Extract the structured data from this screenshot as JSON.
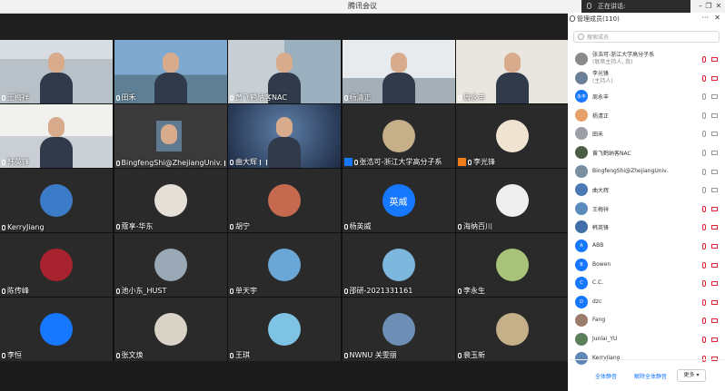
{
  "window": {
    "title": "腾讯会议",
    "speaking_label": "正在讲话:",
    "min": "–",
    "restore": "❐",
    "close": "✕"
  },
  "tiles": [
    {
      "name": "王梅祥",
      "kind": "video"
    },
    {
      "name": "田禾",
      "kind": "video"
    },
    {
      "name": "黄飞鹤纳客NAC",
      "kind": "video"
    },
    {
      "name": "杨清正",
      "kind": "video"
    },
    {
      "name": "周永丰",
      "kind": "video"
    },
    {
      "name": "韩英锋",
      "kind": "video"
    },
    {
      "name": "BingfengShi@ZhejiangUniv.",
      "kind": "video"
    },
    {
      "name": "曲大辉",
      "kind": "video"
    },
    {
      "name": "张浩可-浙江大学高分子系",
      "kind": "avatar"
    },
    {
      "name": "李光锋",
      "kind": "avatar"
    },
    {
      "name": "KerryJiang",
      "kind": "avatar"
    },
    {
      "name": "蔻享-华东",
      "kind": "avatar"
    },
    {
      "name": "胡宁",
      "kind": "avatar"
    },
    {
      "name": "杨英威",
      "kind": "text",
      "avatar_text": "英威"
    },
    {
      "name": "海纳百川",
      "kind": "avatar"
    },
    {
      "name": "陈传峰",
      "kind": "avatar"
    },
    {
      "name": "池小东_HUST",
      "kind": "avatar"
    },
    {
      "name": "单天宇",
      "kind": "avatar"
    },
    {
      "name": "邵研-2021331161",
      "kind": "avatar"
    },
    {
      "name": "李永生",
      "kind": "avatar"
    },
    {
      "name": "李恒",
      "kind": "avatar"
    },
    {
      "name": "张文焕",
      "kind": "avatar"
    },
    {
      "name": "王琪",
      "kind": "avatar"
    },
    {
      "name": "NWNU 关雯丽",
      "kind": "avatar"
    },
    {
      "name": "裴玉新",
      "kind": "avatar"
    }
  ],
  "panel": {
    "title": "管理成员(110)",
    "more": "···",
    "close": "✕",
    "search_placeholder": "搜索成员",
    "members": [
      {
        "name": "张浩可-浙江大学高分子系",
        "role": "(联席主持人, 我)",
        "color": "#8a8a8a"
      },
      {
        "name": "李光锋",
        "role": "(主持人)",
        "color": "#6a7f95"
      },
      {
        "name": "周永丰",
        "color": "#1677ff",
        "avatar_text": "永丰"
      },
      {
        "name": "杨清正",
        "color": "#e8a06a"
      },
      {
        "name": "田禾",
        "color": "#9aa0a6"
      },
      {
        "name": "黄飞鹤纳客NAC",
        "color": "#4d5c44"
      },
      {
        "name": "BingfengShi@ZhejiangUniv.",
        "color": "#7b8fa3"
      },
      {
        "name": "曲大辉",
        "color": "#4c78b3"
      },
      {
        "name": "王梅祥",
        "color": "#5a8bbd"
      },
      {
        "name": "韩英锋",
        "color": "#3f6ea8"
      },
      {
        "name": "ABB",
        "color": "#1677ff",
        "avatar_text": "A"
      },
      {
        "name": "Bowen",
        "color": "#1677ff",
        "avatar_text": "B"
      },
      {
        "name": "C.C.",
        "color": "#1677ff",
        "avatar_text": "C"
      },
      {
        "name": "dzc",
        "color": "#1677ff",
        "avatar_text": "D"
      },
      {
        "name": "Fang",
        "color": "#9b7c6a"
      },
      {
        "name": "Junlai_YU",
        "color": "#5b7f5b"
      },
      {
        "name": "KerryJiang",
        "color": "#5f88b6"
      }
    ],
    "mute_all": "全体静音",
    "unmute_all": "解除全体静音",
    "more_button": "更多 ▾"
  }
}
